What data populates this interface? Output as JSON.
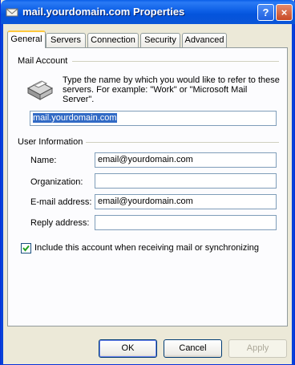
{
  "window": {
    "title": "mail.yourdomain.com Properties",
    "help_label": "?",
    "close_label": "×"
  },
  "tabs": [
    {
      "label": "General",
      "active": true
    },
    {
      "label": "Servers"
    },
    {
      "label": "Connection"
    },
    {
      "label": "Security"
    },
    {
      "label": "Advanced"
    }
  ],
  "mail_account": {
    "group_label": "Mail Account",
    "description": "Type the name by which you would like to refer to these servers.  For example: \"Work\" or \"Microsoft Mail Server\".",
    "account_name": "mail.yourdomain.com"
  },
  "user_information": {
    "group_label": "User Information",
    "name_label": "Name:",
    "name_value": "email@yourdomain.com",
    "organization_label": "Organization:",
    "organization_value": "",
    "email_label": "E-mail address:",
    "email_value": "email@yourdomain.com",
    "reply_label": "Reply address:",
    "reply_value": ""
  },
  "include_checkbox": {
    "label": "Include this account when receiving mail or synchronizing",
    "checked": true
  },
  "buttons": {
    "ok": "OK",
    "cancel": "Cancel",
    "apply": "Apply"
  }
}
